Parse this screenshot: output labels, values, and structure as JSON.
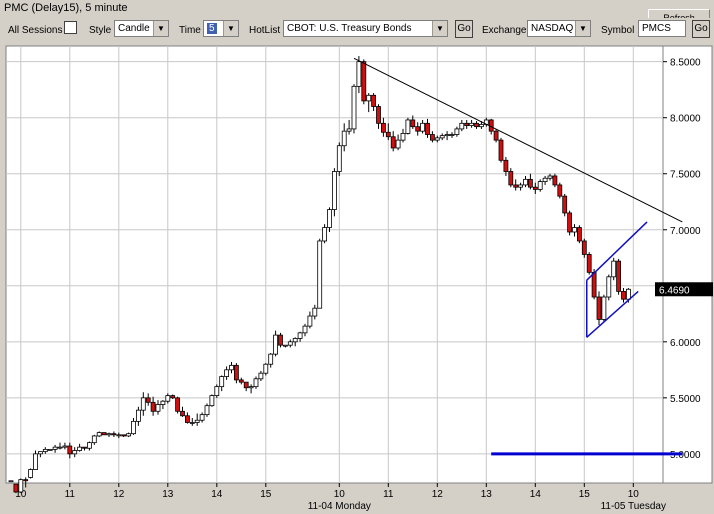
{
  "window": {
    "title": "PMC (Delay15), 5 minute",
    "refresh_label": "Refresh"
  },
  "toolbar": {
    "all_sessions_label": "All Sessions",
    "style_label": "Style",
    "style_value": "Candle",
    "time_label": "Time",
    "time_value": "5",
    "hotlist_label": "HotList",
    "hotlist_value": "CBOT: U.S. Treasury Bonds",
    "go_label": "Go",
    "exchange_label": "Exchange",
    "exchange_value": "NASDAQ",
    "symbol_label": "Symbol",
    "symbol_value": "PMCS",
    "go2_label": "Go"
  },
  "colors": {
    "down_candle": "#d01010",
    "up_candle": "#ffffff",
    "trend_line": "#000000",
    "channel_line": "#1010c0",
    "support_line": "#0000d0",
    "price_tag_bg": "#000000",
    "grid": "#c8c8c8"
  },
  "chart_data": {
    "type": "candlestick",
    "ylim": [
      4.74,
      8.64
    ],
    "yticks": [
      "8.5000",
      "8.0000",
      "7.5000",
      "7.0000",
      "6.5000",
      "6.0000",
      "5.5000",
      "5.0000"
    ],
    "ytick_values": [
      8.5,
      8.0,
      7.5,
      7.0,
      6.5,
      6.0,
      5.5,
      5.0
    ],
    "xticks": [
      "10",
      "11",
      "12",
      "13",
      "14",
      "15",
      "10",
      "11",
      "12",
      "13",
      "14",
      "15",
      "10"
    ],
    "xtick_bars": [
      2,
      12,
      22,
      32,
      42,
      52,
      67,
      77,
      87,
      97,
      107,
      117,
      127
    ],
    "session_labels": [
      {
        "text": "11-04 Monday",
        "bar": 67
      },
      {
        "text": "11-05 Tuesday",
        "bar": 127
      }
    ],
    "last_price_label": "6.4690",
    "last_price": 6.469,
    "candles": [
      [
        4.76,
        4.76,
        4.76,
        4.76
      ],
      [
        4.73,
        4.73,
        4.65,
        4.66
      ],
      [
        4.66,
        4.78,
        4.65,
        4.77
      ],
      [
        4.77,
        4.79,
        4.7,
        4.76
      ],
      [
        4.79,
        4.87,
        4.78,
        4.86
      ],
      [
        4.86,
        5.03,
        4.86,
        5.0
      ],
      [
        5.0,
        5.02,
        4.97,
        5.02
      ],
      [
        5.02,
        5.06,
        5.0,
        5.04
      ],
      [
        5.04,
        5.04,
        5.03,
        5.04
      ],
      [
        5.04,
        5.08,
        5.01,
        5.06
      ],
      [
        5.06,
        5.1,
        5.04,
        5.06
      ],
      [
        5.06,
        5.1,
        5.04,
        5.07
      ],
      [
        5.07,
        5.1,
        4.96,
        5.0
      ],
      [
        5.0,
        5.06,
        4.97,
        5.03
      ],
      [
        5.03,
        5.09,
        5.02,
        5.06
      ],
      [
        5.06,
        5.06,
        5.03,
        5.05
      ],
      [
        5.05,
        5.11,
        5.03,
        5.1
      ],
      [
        5.1,
        5.17,
        5.08,
        5.16
      ],
      [
        5.16,
        5.2,
        5.15,
        5.19
      ],
      [
        5.19,
        5.19,
        5.17,
        5.17
      ],
      [
        5.17,
        5.19,
        5.15,
        5.18
      ],
      [
        5.18,
        5.2,
        5.15,
        5.17
      ],
      [
        5.17,
        5.19,
        5.14,
        5.17
      ],
      [
        5.17,
        5.17,
        5.15,
        5.16
      ],
      [
        5.16,
        5.19,
        5.15,
        5.18
      ],
      [
        5.18,
        5.32,
        5.17,
        5.29
      ],
      [
        5.29,
        5.42,
        5.25,
        5.39
      ],
      [
        5.39,
        5.55,
        5.34,
        5.5
      ],
      [
        5.5,
        5.54,
        5.43,
        5.46
      ],
      [
        5.46,
        5.51,
        5.34,
        5.38
      ],
      [
        5.38,
        5.48,
        5.35,
        5.44
      ],
      [
        5.44,
        5.48,
        5.4,
        5.47
      ],
      [
        5.47,
        5.54,
        5.45,
        5.52
      ],
      [
        5.52,
        5.53,
        5.49,
        5.5
      ],
      [
        5.5,
        5.51,
        5.36,
        5.38
      ],
      [
        5.38,
        5.42,
        5.33,
        5.34
      ],
      [
        5.34,
        5.37,
        5.27,
        5.28
      ],
      [
        5.28,
        5.32,
        5.25,
        5.28
      ],
      [
        5.28,
        5.36,
        5.25,
        5.3
      ],
      [
        5.3,
        5.37,
        5.28,
        5.35
      ],
      [
        5.35,
        5.45,
        5.33,
        5.43
      ],
      [
        5.43,
        5.53,
        5.42,
        5.52
      ],
      [
        5.52,
        5.62,
        5.5,
        5.6
      ],
      [
        5.6,
        5.7,
        5.56,
        5.69
      ],
      [
        5.69,
        5.78,
        5.66,
        5.75
      ],
      [
        5.75,
        5.82,
        5.72,
        5.79
      ],
      [
        5.79,
        5.81,
        5.63,
        5.66
      ],
      [
        5.66,
        5.68,
        5.62,
        5.64
      ],
      [
        5.64,
        5.64,
        5.56,
        5.59
      ],
      [
        5.59,
        5.62,
        5.54,
        5.6
      ],
      [
        5.6,
        5.69,
        5.58,
        5.67
      ],
      [
        5.67,
        5.74,
        5.65,
        5.72
      ],
      [
        5.72,
        5.81,
        5.7,
        5.8
      ],
      [
        5.8,
        5.9,
        5.77,
        5.89
      ],
      [
        5.89,
        6.1,
        5.87,
        6.06
      ],
      [
        6.06,
        6.08,
        5.95,
        5.97
      ],
      [
        5.97,
        5.97,
        5.95,
        5.97
      ],
      [
        5.97,
        6.02,
        5.95,
        6.0
      ],
      [
        6.0,
        6.04,
        5.96,
        6.03
      ],
      [
        6.03,
        6.09,
        6.0,
        6.08
      ],
      [
        6.08,
        6.16,
        6.05,
        6.14
      ],
      [
        6.14,
        6.27,
        6.12,
        6.23
      ],
      [
        6.23,
        6.33,
        6.2,
        6.3
      ],
      [
        6.3,
        6.92,
        6.65,
        6.9
      ],
      [
        6.9,
        7.05,
        6.88,
        7.02
      ],
      [
        7.02,
        7.2,
        6.98,
        7.18
      ],
      [
        7.18,
        7.55,
        7.12,
        7.52
      ],
      [
        7.52,
        7.78,
        7.48,
        7.75
      ],
      [
        7.75,
        7.95,
        7.7,
        7.88
      ],
      [
        7.88,
        7.98,
        7.85,
        7.9
      ],
      [
        7.9,
        8.3,
        7.86,
        8.28
      ],
      [
        8.28,
        8.55,
        8.22,
        8.5
      ],
      [
        8.5,
        8.52,
        8.12,
        8.15
      ],
      [
        8.15,
        8.22,
        8.05,
        8.2
      ],
      [
        8.2,
        8.22,
        8.06,
        8.1
      ],
      [
        8.1,
        8.12,
        7.9,
        7.95
      ],
      [
        7.95,
        8.0,
        7.83,
        7.87
      ],
      [
        7.87,
        7.95,
        7.8,
        7.83
      ],
      [
        7.83,
        7.88,
        7.7,
        7.73
      ],
      [
        7.73,
        7.85,
        7.71,
        7.8
      ],
      [
        7.8,
        7.9,
        7.78,
        7.86
      ],
      [
        7.86,
        8.0,
        7.85,
        7.98
      ],
      [
        7.98,
        8.02,
        7.9,
        7.92
      ],
      [
        7.92,
        7.96,
        7.84,
        7.88
      ],
      [
        7.88,
        7.98,
        7.86,
        7.95
      ],
      [
        7.95,
        7.99,
        7.82,
        7.85
      ],
      [
        7.85,
        7.88,
        7.78,
        7.8
      ],
      [
        7.8,
        7.84,
        7.78,
        7.82
      ],
      [
        7.82,
        7.86,
        7.8,
        7.84
      ],
      [
        7.84,
        7.88,
        7.8,
        7.85
      ],
      [
        7.85,
        7.87,
        7.82,
        7.85
      ],
      [
        7.85,
        7.92,
        7.83,
        7.9
      ],
      [
        7.9,
        7.98,
        7.88,
        7.95
      ],
      [
        7.95,
        7.98,
        7.9,
        7.93
      ],
      [
        7.93,
        7.98,
        7.91,
        7.95
      ],
      [
        7.95,
        7.97,
        7.9,
        7.92
      ],
      [
        7.92,
        7.97,
        7.9,
        7.94
      ],
      [
        7.94,
        8.0,
        7.92,
        7.98
      ],
      [
        7.98,
        7.99,
        7.85,
        7.88
      ],
      [
        7.88,
        7.9,
        7.78,
        7.8
      ],
      [
        7.8,
        7.82,
        7.6,
        7.62
      ],
      [
        7.62,
        7.65,
        7.48,
        7.52
      ],
      [
        7.52,
        7.55,
        7.38,
        7.4
      ],
      [
        7.4,
        7.45,
        7.35,
        7.38
      ],
      [
        7.38,
        7.42,
        7.35,
        7.4
      ],
      [
        7.4,
        7.48,
        7.38,
        7.45
      ],
      [
        7.45,
        7.5,
        7.36,
        7.38
      ],
      [
        7.38,
        7.42,
        7.32,
        7.36
      ],
      [
        7.36,
        7.45,
        7.34,
        7.43
      ],
      [
        7.43,
        7.48,
        7.4,
        7.46
      ],
      [
        7.46,
        7.5,
        7.44,
        7.48
      ],
      [
        7.48,
        7.5,
        7.38,
        7.4
      ],
      [
        7.4,
        7.42,
        7.28,
        7.3
      ],
      [
        7.3,
        7.32,
        7.12,
        7.15
      ],
      [
        7.15,
        7.17,
        6.95,
        6.98
      ],
      [
        6.98,
        7.05,
        6.94,
        7.02
      ],
      [
        7.02,
        7.04,
        6.88,
        6.9
      ],
      [
        6.9,
        6.92,
        6.75,
        6.78
      ],
      [
        6.78,
        6.8,
        6.6,
        6.62
      ],
      [
        6.62,
        6.65,
        6.38,
        6.4
      ],
      [
        6.4,
        6.45,
        6.15,
        6.2
      ],
      [
        6.2,
        6.42,
        6.18,
        6.4
      ],
      [
        6.4,
        6.6,
        6.37,
        6.58
      ],
      [
        6.58,
        6.75,
        6.55,
        6.72
      ],
      [
        6.72,
        6.74,
        6.42,
        6.45
      ],
      [
        6.45,
        6.48,
        6.35,
        6.38
      ],
      [
        6.38,
        6.48,
        6.35,
        6.469
      ]
    ],
    "trend_line": [
      [
        70,
        8.53
      ],
      [
        137,
        7.07
      ]
    ],
    "channel_lines": [
      [
        [
          117.5,
          6.04
        ],
        [
          128,
          6.45
        ]
      ],
      [
        [
          117.5,
          6.55
        ],
        [
          129.8,
          7.07
        ]
      ],
      [
        [
          117.5,
          6.04
        ],
        [
          117.5,
          6.55
        ]
      ]
    ],
    "support_line": {
      "bar_start": 98,
      "bar_end": 137,
      "y": 5.0
    }
  }
}
